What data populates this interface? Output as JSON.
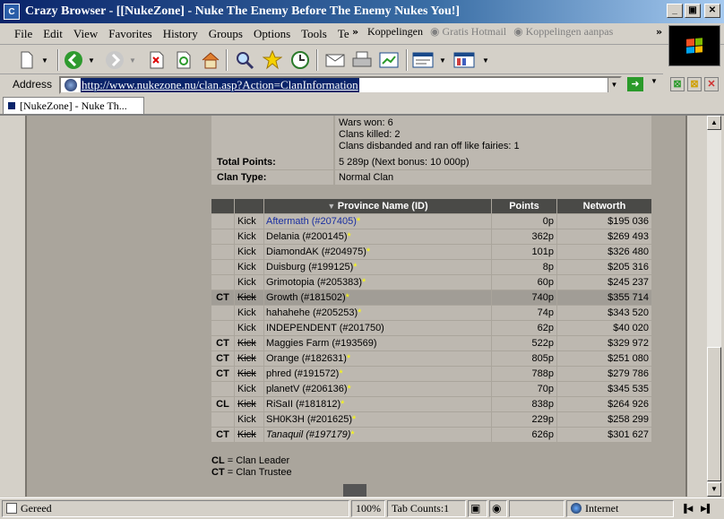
{
  "window": {
    "title": "Crazy Browser - [[NukeZone] - Nuke The Enemy Before The Enemy Nukes You!]"
  },
  "menu": [
    "File",
    "Edit",
    "View",
    "Favorites",
    "History",
    "Groups",
    "Options",
    "Tools",
    "Te"
  ],
  "links": {
    "label": "Koppelingen",
    "items": [
      "Gratis Hotmail",
      "Koppelingen aanpas"
    ]
  },
  "address": {
    "label": "Address",
    "url": "http://www.nukezone.nu/clan.asp?Action=ClanInformation"
  },
  "tab": {
    "label": "[NukeZone] - Nuke Th..."
  },
  "info": {
    "wars_won": "Wars won: 6",
    "clans_killed": "Clans killed: 2",
    "clans_disbanded": "Clans disbanded and ran off like fairies: 1",
    "total_points_label": "Total Points:",
    "total_points_value": "5 289p (Next bonus: 10 000p)",
    "clan_type_label": "Clan Type:",
    "clan_type_value": "Normal Clan"
  },
  "table": {
    "headers": {
      "province": "Province Name (ID)",
      "points": "Points",
      "networth": "Networth"
    },
    "rows": [
      {
        "role": "",
        "kick": "Kick",
        "kick_struck": false,
        "name": "Aftermath (#207405)",
        "star": "*",
        "points": "0p",
        "networth": "$195 036",
        "link": true,
        "italic": false,
        "highlight": false
      },
      {
        "role": "",
        "kick": "Kick",
        "kick_struck": false,
        "name": "Delania (#200145)",
        "star": "*",
        "points": "362p",
        "networth": "$269 493",
        "link": false,
        "italic": false,
        "highlight": false
      },
      {
        "role": "",
        "kick": "Kick",
        "kick_struck": false,
        "name": "DiamondAK (#204975)",
        "star": "*",
        "points": "101p",
        "networth": "$326 480",
        "link": false,
        "italic": false,
        "highlight": false
      },
      {
        "role": "",
        "kick": "Kick",
        "kick_struck": false,
        "name": "Duisburg (#199125)",
        "star": "*",
        "points": "8p",
        "networth": "$205 316",
        "link": false,
        "italic": false,
        "highlight": false
      },
      {
        "role": "",
        "kick": "Kick",
        "kick_struck": false,
        "name": "Grimotopia (#205383)",
        "star": "*",
        "points": "60p",
        "networth": "$245 237",
        "link": false,
        "italic": false,
        "highlight": false
      },
      {
        "role": "CT",
        "kick": "Kick",
        "kick_struck": true,
        "name": "Growth (#181502)",
        "star": "*",
        "points": "740p",
        "networth": "$355 714",
        "link": false,
        "italic": false,
        "highlight": true
      },
      {
        "role": "",
        "kick": "Kick",
        "kick_struck": false,
        "name": "hahahehe (#205253)",
        "star": "*",
        "points": "74p",
        "networth": "$343 520",
        "link": false,
        "italic": false,
        "highlight": false
      },
      {
        "role": "",
        "kick": "Kick",
        "kick_struck": false,
        "name": "INDEPENDENT (#201750)",
        "star": "",
        "points": "62p",
        "networth": "$40 020",
        "link": false,
        "italic": false,
        "highlight": false
      },
      {
        "role": "CT",
        "kick": "Kick",
        "kick_struck": true,
        "name": "Maggies Farm (#193569)",
        "star": "",
        "points": "522p",
        "networth": "$329 972",
        "link": false,
        "italic": false,
        "highlight": false
      },
      {
        "role": "CT",
        "kick": "Kick",
        "kick_struck": true,
        "name": "Orange (#182631)",
        "star": "*",
        "points": "805p",
        "networth": "$251 080",
        "link": false,
        "italic": false,
        "highlight": false
      },
      {
        "role": "CT",
        "kick": "Kick",
        "kick_struck": true,
        "name": "phred (#191572)",
        "star": "*",
        "points": "788p",
        "networth": "$279 786",
        "link": false,
        "italic": false,
        "highlight": false
      },
      {
        "role": "",
        "kick": "Kick",
        "kick_struck": false,
        "name": "planetV (#206136)",
        "star": "*",
        "points": "70p",
        "networth": "$345 535",
        "link": false,
        "italic": false,
        "highlight": false
      },
      {
        "role": "CL",
        "kick": "Kick",
        "kick_struck": true,
        "name": "RiSaII (#181812)",
        "star": "*",
        "points": "838p",
        "networth": "$264 926",
        "link": false,
        "italic": false,
        "highlight": false
      },
      {
        "role": "",
        "kick": "Kick",
        "kick_struck": false,
        "name": "SH0K3H (#201625)",
        "star": "*",
        "points": "229p",
        "networth": "$258 299",
        "link": false,
        "italic": false,
        "highlight": false
      },
      {
        "role": "CT",
        "kick": "Kick",
        "kick_struck": true,
        "name": "Tanaquil (#197179)",
        "star": "*",
        "points": "626p",
        "networth": "$301 627",
        "link": false,
        "italic": true,
        "highlight": false
      }
    ]
  },
  "legend": {
    "cl_abbr": "CL",
    "cl_text": " = Clan Leader",
    "ct_abbr": "CT",
    "ct_text": " = Clan Trustee"
  },
  "status": {
    "text": "Gereed",
    "zoom": "100%",
    "tabs": "Tab Counts:1",
    "zone": "Internet"
  },
  "colors": {
    "header_bg": "#4a4a47",
    "row_bg": "#bdb8b0",
    "highlight_bg": "#a19d96",
    "link": "#1a2fa0",
    "star": "#ffff00"
  }
}
